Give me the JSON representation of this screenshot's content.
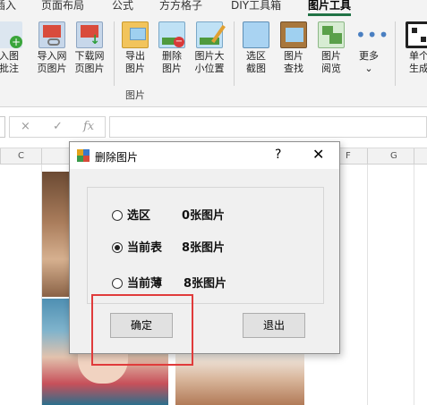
{
  "ribbon": {
    "tabs": [
      {
        "label": "插入",
        "active": false
      },
      {
        "label": "页面布局",
        "active": false
      },
      {
        "label": "公式",
        "active": false
      },
      {
        "label": "方方格子",
        "active": false
      },
      {
        "label": "DIY工具箱",
        "active": false
      },
      {
        "label": "图片工具",
        "active": true
      }
    ],
    "buttons": [
      {
        "label_top": "入图",
        "label_bottom": "批注",
        "icon": "insert-picture-comment-icon"
      },
      {
        "label_top": "导入网",
        "label_bottom": "页图片",
        "icon": "import-web-picture-icon"
      },
      {
        "label_top": "下载网",
        "label_bottom": "页图片",
        "icon": "download-web-picture-icon"
      },
      {
        "label_top": "导出",
        "label_bottom": "图片",
        "icon": "export-picture-icon"
      },
      {
        "label_top": "删除",
        "label_bottom": "图片",
        "icon": "delete-picture-icon"
      },
      {
        "label_top": "图片大",
        "label_bottom": "小位置",
        "icon": "picture-size-position-icon"
      },
      {
        "label_top": "选区",
        "label_bottom": "截图",
        "icon": "selection-screenshot-icon"
      },
      {
        "label_top": "图片",
        "label_bottom": "查找",
        "icon": "picture-find-icon"
      },
      {
        "label_top": "图片",
        "label_bottom": "阅览",
        "icon": "picture-browse-icon"
      },
      {
        "label_top": "更多",
        "label_bottom": "⌄",
        "icon": "more-icon"
      },
      {
        "label_top": "单个",
        "label_bottom": "生成",
        "icon": "qr-code-icon"
      }
    ],
    "group_label": "图片"
  },
  "formula_bar": {
    "cancel_glyph": "×",
    "confirm_glyph": "✓",
    "fx_label": "fx",
    "value": ""
  },
  "columns": {
    "c": "C",
    "f": "F",
    "g": "G"
  },
  "dialog": {
    "title": "删除图片",
    "help": "?",
    "close": "✕",
    "options": [
      {
        "label": "选区",
        "count": "0张图片",
        "selected": false
      },
      {
        "label": "当前表",
        "count": "8张图片",
        "selected": true
      },
      {
        "label": "当前薄",
        "count": "8张图片",
        "selected": false
      }
    ],
    "ok_label": "确定",
    "cancel_label": "退出"
  },
  "colors": {
    "accent": "#217346",
    "highlight": "#e03b3b"
  }
}
